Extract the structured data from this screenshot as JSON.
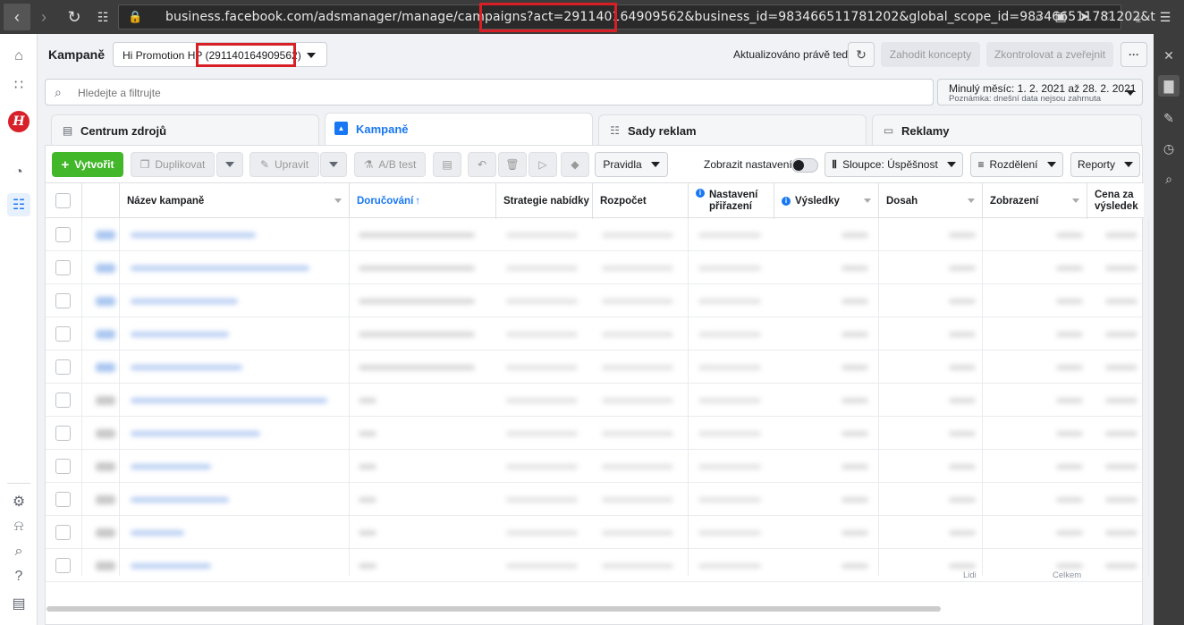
{
  "browser": {
    "url": "business.facebook.com/adsmanager/manage/campaigns?act=291140164909562&business_id=983466511781202&global_scope_id=983466511781202&t",
    "back_icon": "chevron-left-icon",
    "forward_icon": "chevron-right-icon"
  },
  "header": {
    "title": "Kampaně",
    "account_name": "Hi Promotion HP (291140164909562)",
    "updated_text": "Aktualizováno právě teď",
    "discard_label": "Zahodit koncepty",
    "publish_label": "Zkontrolovat a zveřejnit",
    "more_label": "···"
  },
  "search": {
    "placeholder": "Hledejte a filtrujte"
  },
  "date_range": {
    "label": "Minulý měsíc: 1. 2. 2021 až 28. 2. 2021",
    "note": "Poznámka: dnešní data nejsou zahrnuta"
  },
  "tabs": [
    {
      "label": "Centrum zdrojů",
      "icon": "clipboard-icon"
    },
    {
      "label": "Kampaně",
      "icon": "folder-icon"
    },
    {
      "label": "Sady reklam",
      "icon": "grid-icon"
    },
    {
      "label": "Reklamy",
      "icon": "ad-icon"
    }
  ],
  "toolbar": {
    "create": "Vytvořit",
    "duplicate": "Duplikovat",
    "edit": "Upravit",
    "ab_test": "A/B test",
    "rules": "Pravidla",
    "show_settings": "Zobrazit nastavení",
    "columns": "Sloupce: Úspěšnost",
    "breakdown": "Rozdělení",
    "reports": "Reporty"
  },
  "table": {
    "columns": [
      "Název kampaně",
      "Doručování",
      "Strategie nabídky",
      "Rozpočet",
      "Nastavení přiřazení",
      "Výsledky",
      "Dosah",
      "Zobrazení",
      "Cena za výsledek"
    ],
    "row_count": 11,
    "footer": {
      "reach_label": "Lidi",
      "impressions_label": "Celkem"
    }
  }
}
